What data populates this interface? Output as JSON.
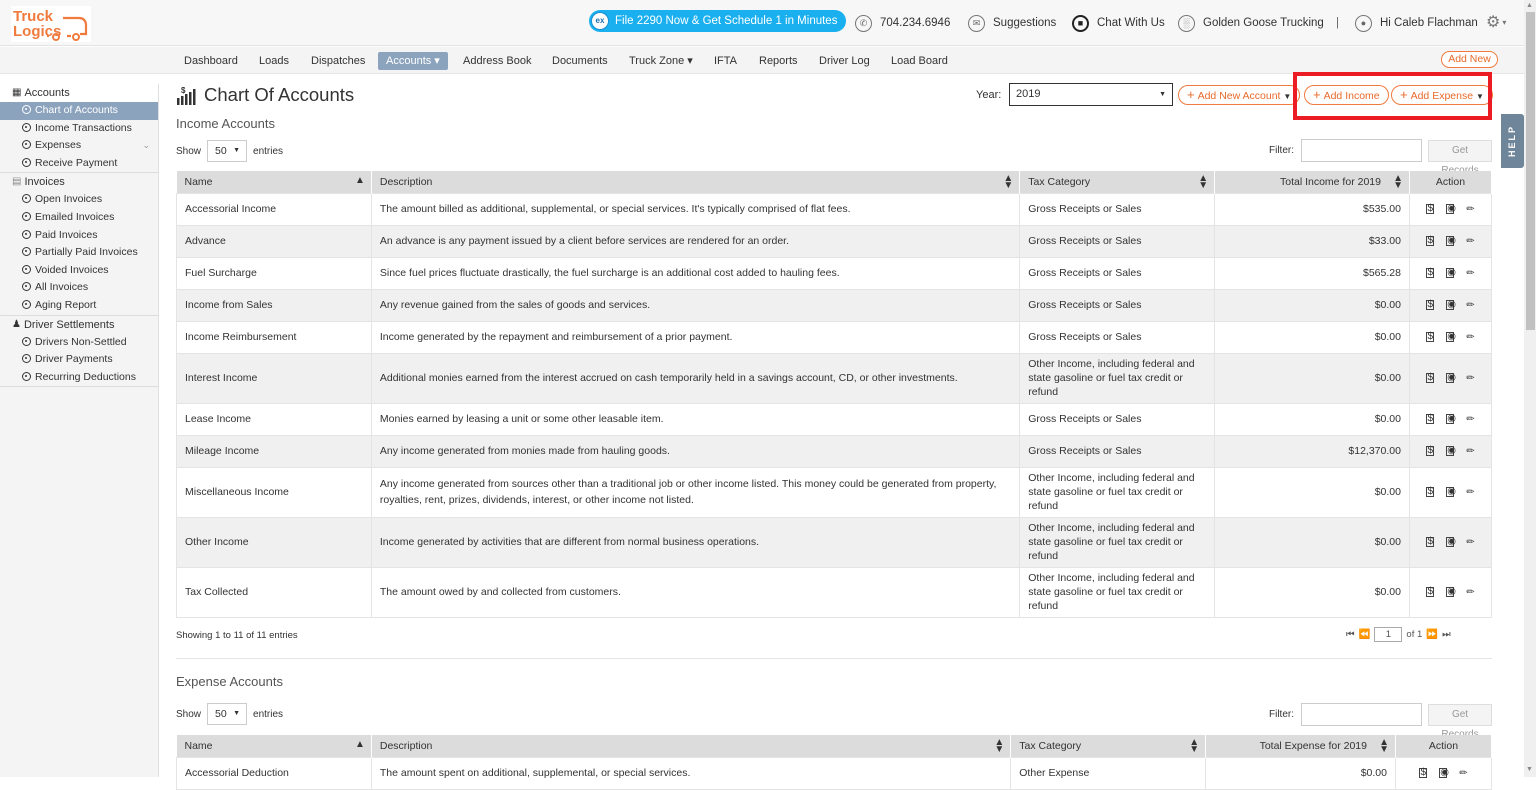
{
  "header": {
    "logo_line1": "Truck",
    "logo_line2": "Logics",
    "brand_color": "#f07b3f",
    "promo": "File 2290 Now & Get Schedule 1 in Minutes",
    "promo_icon": "ex",
    "phone": "704.234.6946",
    "suggestions": "Suggestions",
    "chat": "Chat With Us",
    "company": "Golden Goose Trucking",
    "separator": "|",
    "greeting": "Hi Caleb Flachman"
  },
  "nav": {
    "items": [
      "Dashboard",
      "Loads",
      "Dispatches",
      "Accounts ▾",
      "Address Book",
      "Documents",
      "Truck Zone ▾",
      "IFTA",
      "Reports",
      "Driver Log",
      "Load Board"
    ],
    "add_new": "Add New"
  },
  "sidebar": {
    "sections": [
      {
        "label": "Accounts",
        "items": [
          "Chart of Accounts",
          "Income Transactions",
          "Expenses",
          "Receive Payment"
        ]
      },
      {
        "label": "Invoices",
        "items": [
          "Open Invoices",
          "Emailed Invoices",
          "Paid Invoices",
          "Partially Paid Invoices",
          "Voided Invoices",
          "All Invoices",
          "Aging Report"
        ]
      },
      {
        "label": "Driver Settlements",
        "items": [
          "Drivers Non-Settled",
          "Driver Payments",
          "Recurring Deductions"
        ]
      }
    ]
  },
  "page": {
    "title": "Chart Of Accounts",
    "year_label": "Year:",
    "year_value": "2019",
    "add_account": "Add New Account",
    "add_income": "Add Income",
    "add_expense": "Add Expense",
    "help": "HELP"
  },
  "income": {
    "heading": "Income Accounts",
    "show": "Show",
    "entries_value": "50",
    "entries": "entries",
    "filter_label": "Filter:",
    "filter_value": "",
    "get_records": "Get Records",
    "columns": [
      "Name",
      "Description",
      "Tax Category",
      "Total Income for 2019",
      "Action"
    ],
    "rows": [
      [
        "Accessorial Income",
        "The amount billed as additional, supplemental, or special services. It's typically comprised of flat fees.",
        "Gross Receipts or Sales",
        "$535.00"
      ],
      [
        "Advance",
        "An advance is any payment issued by a client before services are rendered for an order.",
        "Gross Receipts or Sales",
        "$33.00"
      ],
      [
        "Fuel Surcharge",
        "Since fuel prices fluctuate drastically, the fuel surcharge is an additional cost added to hauling fees.",
        "Gross Receipts or Sales",
        "$565.28"
      ],
      [
        "Income from Sales",
        "Any revenue gained from the sales of goods and services.",
        "Gross Receipts or Sales",
        "$0.00"
      ],
      [
        "Income Reimbursement",
        "Income generated by the repayment and reimbursement of a prior payment.",
        "Gross Receipts or Sales",
        "$0.00"
      ],
      [
        "Interest Income",
        "Additional monies earned from the interest accrued on cash temporarily held in a savings account, CD, or other investments.",
        "Other Income, including federal and state gasoline or fuel tax credit or refund",
        "$0.00"
      ],
      [
        "Lease Income",
        "Monies earned by leasing a unit or some other leasable item.",
        "Gross Receipts or Sales",
        "$0.00"
      ],
      [
        "Mileage Income",
        "Any income generated from monies made from hauling goods.",
        "Gross Receipts or Sales",
        "$12,370.00"
      ],
      [
        "Miscellaneous Income",
        "Any income generated from sources other than a traditional job or other income listed. This money could be generated from property, royalties, rent, prizes, dividends, interest, or other income not listed.",
        "Other Income, including federal and state gasoline or fuel tax credit or refund",
        "$0.00"
      ],
      [
        "Other Income",
        "Income generated by activities that are different from normal business operations.",
        "Other Income, including federal and state gasoline or fuel tax credit or refund",
        "$0.00"
      ],
      [
        "Tax Collected",
        "The amount owed by and collected from customers.",
        "Other Income, including federal and state gasoline or fuel tax credit or refund",
        "$0.00"
      ]
    ],
    "showing": "Showing 1 to 11 of 11 entries",
    "page_value": "1",
    "page_of": "of 1"
  },
  "expense": {
    "heading": "Expense Accounts",
    "show": "Show",
    "entries_value": "50",
    "entries": "entries",
    "filter_label": "Filter:",
    "filter_value": "",
    "get_records": "Get Records",
    "columns": [
      "Name",
      "Description",
      "Tax Category",
      "Total Expense for 2019",
      "Action"
    ],
    "rows": [
      [
        "Accessorial Deduction",
        "The amount spent on additional, supplemental, or special services.",
        "Other Expense",
        "$0.00"
      ]
    ]
  }
}
